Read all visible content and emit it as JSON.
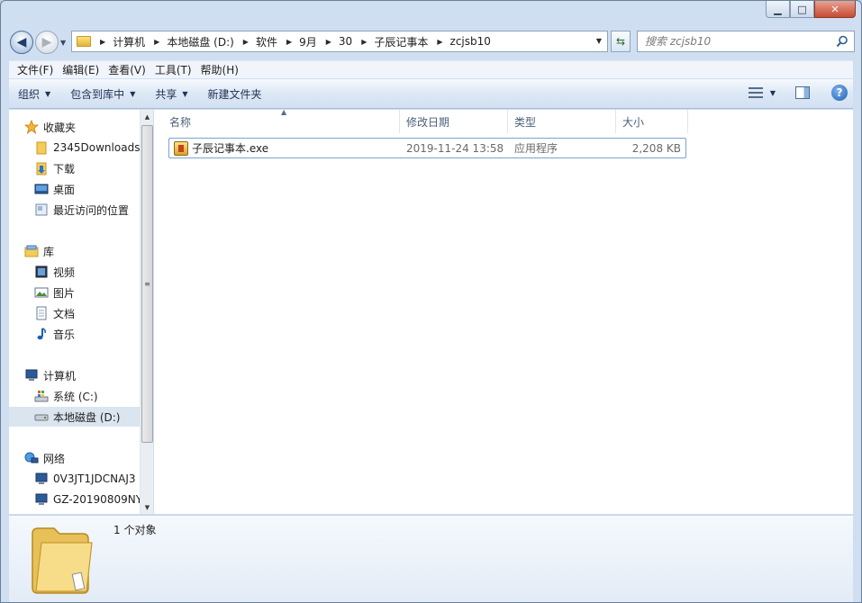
{
  "window": {
    "caption_buttons": [
      "minimize",
      "maximize",
      "close"
    ]
  },
  "nav": {
    "back_icon": "back-arrow-icon",
    "forward_icon": "forward-arrow-icon"
  },
  "address": {
    "crumbs": [
      "计算机",
      "本地磁盘 (D:)",
      "软件",
      "9月",
      "30",
      "子辰记事本",
      "zcjsb10"
    ]
  },
  "search": {
    "placeholder": "搜索 zcjsb10"
  },
  "menubar": {
    "items": [
      "文件(F)",
      "编辑(E)",
      "查看(V)",
      "工具(T)",
      "帮助(H)"
    ]
  },
  "toolbar": {
    "organize": "组织",
    "include_in_library": "包含到库中",
    "share": "共享",
    "new_folder": "新建文件夹"
  },
  "sidebar": {
    "favorites": {
      "label": "收藏夹",
      "items": [
        "2345Downloads",
        "下载",
        "桌面",
        "最近访问的位置"
      ]
    },
    "libraries": {
      "label": "库",
      "items": [
        "视频",
        "图片",
        "文档",
        "音乐"
      ]
    },
    "computer": {
      "label": "计算机",
      "items": [
        "系统 (C:)",
        "本地磁盘 (D:)"
      ]
    },
    "network": {
      "label": "网络",
      "items": [
        "0V3JT1JDCNAJ3",
        "GZ-20190809NY"
      ]
    }
  },
  "columns": {
    "name": "名称",
    "date": "修改日期",
    "type": "类型",
    "size": "大小"
  },
  "files": [
    {
      "name": "子辰记事本.exe",
      "date": "2019-11-24 13:58",
      "type": "应用程序",
      "size": "2,208 KB"
    }
  ],
  "details": {
    "count": "1 个对象"
  },
  "colors": {
    "accent": "#cfdff1",
    "selection_border": "#7da2ce"
  }
}
